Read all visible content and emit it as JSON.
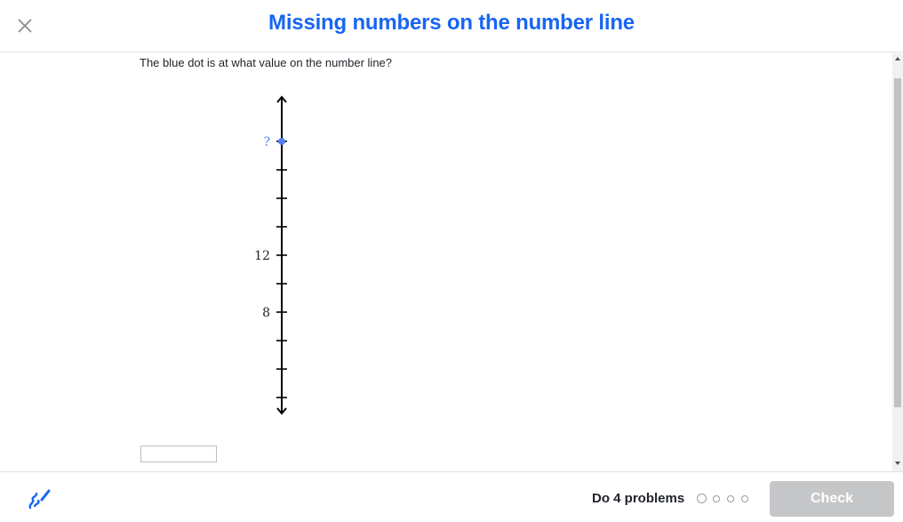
{
  "header": {
    "title": "Missing numbers on the number line",
    "close_icon": "close-icon"
  },
  "question": {
    "prompt": "The blue dot is at what value on the number line?"
  },
  "number_line": {
    "orientation": "vertical",
    "unknown_label": "?",
    "labels": [
      {
        "text": "12",
        "value": 12
      },
      {
        "text": "8",
        "value": 8
      }
    ],
    "tick_values": [
      2,
      4,
      6,
      8,
      10,
      12,
      14,
      16,
      18,
      20
    ],
    "dot_value": 20,
    "dot_color": "#4f81f4",
    "arrows": "both ends"
  },
  "answer": {
    "value": ""
  },
  "footer": {
    "scratchpad_icon": "scratchpad-pencil-icon",
    "progress_label": "Do 4 problems",
    "total_problems": 4,
    "completed_problems": 0,
    "check_label": "Check"
  },
  "colors": {
    "accent": "#1865f2",
    "check_disabled": "#c5c6c8"
  }
}
